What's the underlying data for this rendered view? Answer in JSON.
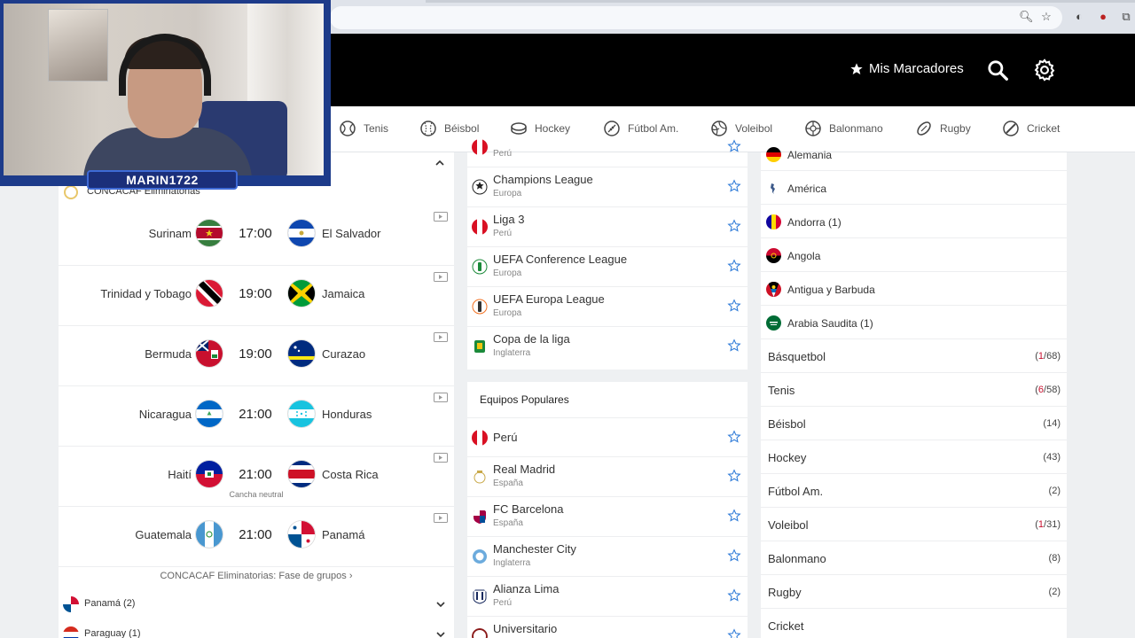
{
  "streamer": {
    "name": "MARIN1722"
  },
  "topnav": {
    "my_scores": "Mis Marcadores"
  },
  "sports_tabs": [
    {
      "label": "Tenis",
      "icon": "tennis-icon"
    },
    {
      "label": "Béisbol",
      "icon": "baseball-icon"
    },
    {
      "label": "Hockey",
      "icon": "hockey-icon"
    },
    {
      "label": "Fútbol Am.",
      "icon": "american-football-icon"
    },
    {
      "label": "Voleibol",
      "icon": "volleyball-icon"
    },
    {
      "label": "Balonmano",
      "icon": "handball-icon"
    },
    {
      "label": "Rugby",
      "icon": "rugby-icon"
    },
    {
      "label": "Cricket",
      "icon": "cricket-icon"
    }
  ],
  "competition": {
    "name": "CONCACAF Eliminatorias",
    "footer_link": "CONCACAF Eliminatorias: Fase de grupos ›"
  },
  "matches": [
    {
      "home": "Surinam",
      "time": "17:00",
      "away": "El Salvador",
      "note": ""
    },
    {
      "home": "Trinidad y Tobago",
      "time": "19:00",
      "away": "Jamaica",
      "note": ""
    },
    {
      "home": "Bermuda",
      "time": "19:00",
      "away": "Curazao",
      "note": ""
    },
    {
      "home": "Nicaragua",
      "time": "21:00",
      "away": "Honduras",
      "note": ""
    },
    {
      "home": "Haití",
      "time": "21:00",
      "away": "Costa Rica",
      "note": "Cancha neutral"
    },
    {
      "home": "Guatemala",
      "time": "21:00",
      "away": "Panamá",
      "note": ""
    }
  ],
  "country_groups": [
    {
      "label": "Panamá  (2)"
    },
    {
      "label": "Paraguay  (1)"
    }
  ],
  "leagues": [
    {
      "name": "",
      "region": "Perú"
    },
    {
      "name": "Champions League",
      "region": "Europa"
    },
    {
      "name": "Liga 3",
      "region": "Perú"
    },
    {
      "name": "UEFA Conference League",
      "region": "Europa"
    },
    {
      "name": "UEFA Europa League",
      "region": "Europa"
    },
    {
      "name": "Copa de la liga",
      "region": "Inglaterra"
    }
  ],
  "popular_teams": {
    "title": "Equipos Populares",
    "teams": [
      {
        "name": "Perú",
        "region": ""
      },
      {
        "name": "Real Madrid",
        "region": "España"
      },
      {
        "name": "FC Barcelona",
        "region": "España"
      },
      {
        "name": "Manchester City",
        "region": "Inglaterra"
      },
      {
        "name": "Alianza Lima",
        "region": "Perú"
      },
      {
        "name": "Universitario",
        "region": ""
      }
    ]
  },
  "countries": [
    {
      "name": "Alemania"
    },
    {
      "name": "América"
    },
    {
      "name": "Andorra  (1)"
    },
    {
      "name": "Angola"
    },
    {
      "name": "Antigua y Barbuda"
    },
    {
      "name": "Arabia Saudita  (1)"
    }
  ],
  "sports_list": [
    {
      "name": "Básquetbol",
      "live": "1",
      "count": "/68"
    },
    {
      "name": "Tenis",
      "live": "6",
      "count": "/58"
    },
    {
      "name": "Béisbol",
      "live": "",
      "count": "14"
    },
    {
      "name": "Hockey",
      "live": "",
      "count": "43"
    },
    {
      "name": "Fútbol Am.",
      "live": "",
      "count": "2"
    },
    {
      "name": "Voleibol",
      "live": "1",
      "count": "/31"
    },
    {
      "name": "Balonmano",
      "live": "",
      "count": "8"
    },
    {
      "name": "Rugby",
      "live": "",
      "count": "2"
    },
    {
      "name": "Cricket",
      "live": "",
      "count": ""
    }
  ],
  "colors": {
    "accent_blue": "#2f7bd8",
    "live_red": "#c8102e",
    "nav_bg": "#000000"
  }
}
